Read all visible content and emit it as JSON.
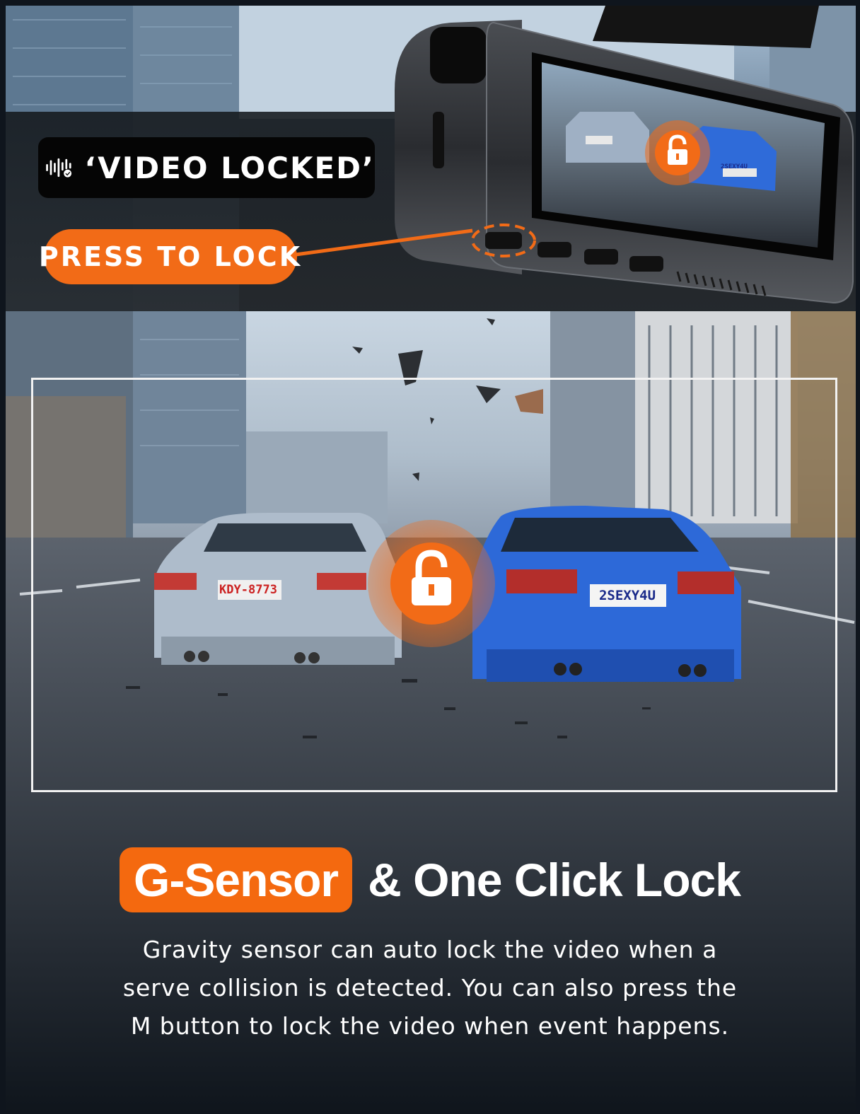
{
  "badge": {
    "text": "‘VIDEO LOCKED’",
    "icon": "voice-wave-check-icon"
  },
  "callout": {
    "text": "PRESS TO LOCK"
  },
  "headline": {
    "highlight": "G-Sensor",
    "rest": "& One Click Lock"
  },
  "description": {
    "lines": [
      "Gravity sensor can auto lock the video when a",
      "serve collision is detected. You can also press the",
      "M button to lock the video when event happens."
    ]
  },
  "plates": {
    "left_car": "KDY-8773",
    "right_car": "2SEXY4U",
    "screen_right": "2SEXY4U"
  },
  "icons": {
    "screen_lock": "lock-icon",
    "scene_lock": "lock-icon"
  },
  "colors": {
    "accent": "#F26B17",
    "badge_bg": "#050505",
    "text": "#FFFFFF"
  }
}
